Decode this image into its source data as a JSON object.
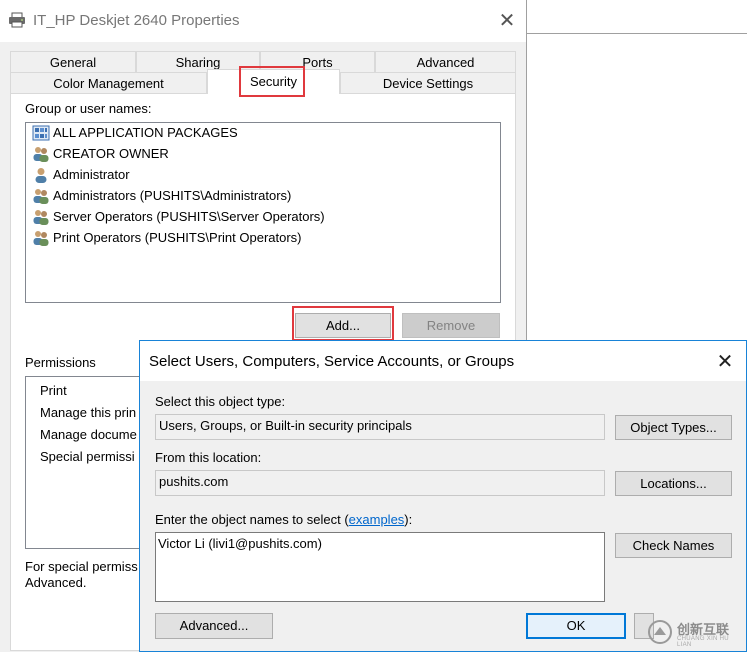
{
  "properties_dialog": {
    "title": "IT_HP Deskjet 2640 Properties",
    "close_glyph": "✕",
    "icon": "printer-icon",
    "tabs_row1": [
      "General",
      "Sharing",
      "Ports",
      "Advanced"
    ],
    "tabs_row2": [
      "Color Management",
      "Security",
      "Device Settings"
    ],
    "active_tab": "Security",
    "group_label": "Group or user names:",
    "users": [
      {
        "name": "ALL APPLICATION PACKAGES",
        "icon": "packages-icon"
      },
      {
        "name": "CREATOR OWNER",
        "icon": "group-icon"
      },
      {
        "name": "Administrator",
        "icon": "user-icon"
      },
      {
        "name": "Administrators (PUSHITS\\Administrators)",
        "icon": "group-icon"
      },
      {
        "name": "Server Operators (PUSHITS\\Server Operators)",
        "icon": "group-icon"
      },
      {
        "name": "Print Operators (PUSHITS\\Print Operators)",
        "icon": "group-icon"
      }
    ],
    "add_button": "Add...",
    "remove_button": "Remove",
    "permissions_label": "Permissions",
    "permissions": [
      "Print",
      "Manage this prin",
      "Manage docume",
      "Special permissi"
    ],
    "special_note_line1": "For special permiss",
    "special_note_line2": "Advanced."
  },
  "select_dialog": {
    "title": "Select Users, Computers, Service Accounts, or Groups",
    "close_glyph": "✕",
    "object_type_label": "Select this object type:",
    "object_type_value": "Users, Groups, or Built-in security principals",
    "object_types_button": "Object Types...",
    "location_label": "From this location:",
    "location_value": "pushits.com",
    "locations_button": "Locations...",
    "names_label_prefix": "Enter the object names to select (",
    "names_label_link": "examples",
    "names_label_suffix": "):",
    "names_value": "Victor Li (livi1@pushits.com)",
    "check_names_button": "Check Names",
    "advanced_button": "Advanced...",
    "ok_button": "OK"
  },
  "watermark": {
    "text": "创新互联",
    "subtext": "CHUANG XIN HU LIAN"
  },
  "colors": {
    "highlight": "#e0393e",
    "dialog_bg": "#f0f0f0",
    "accent": "#0078d7",
    "link": "#0066cc"
  }
}
